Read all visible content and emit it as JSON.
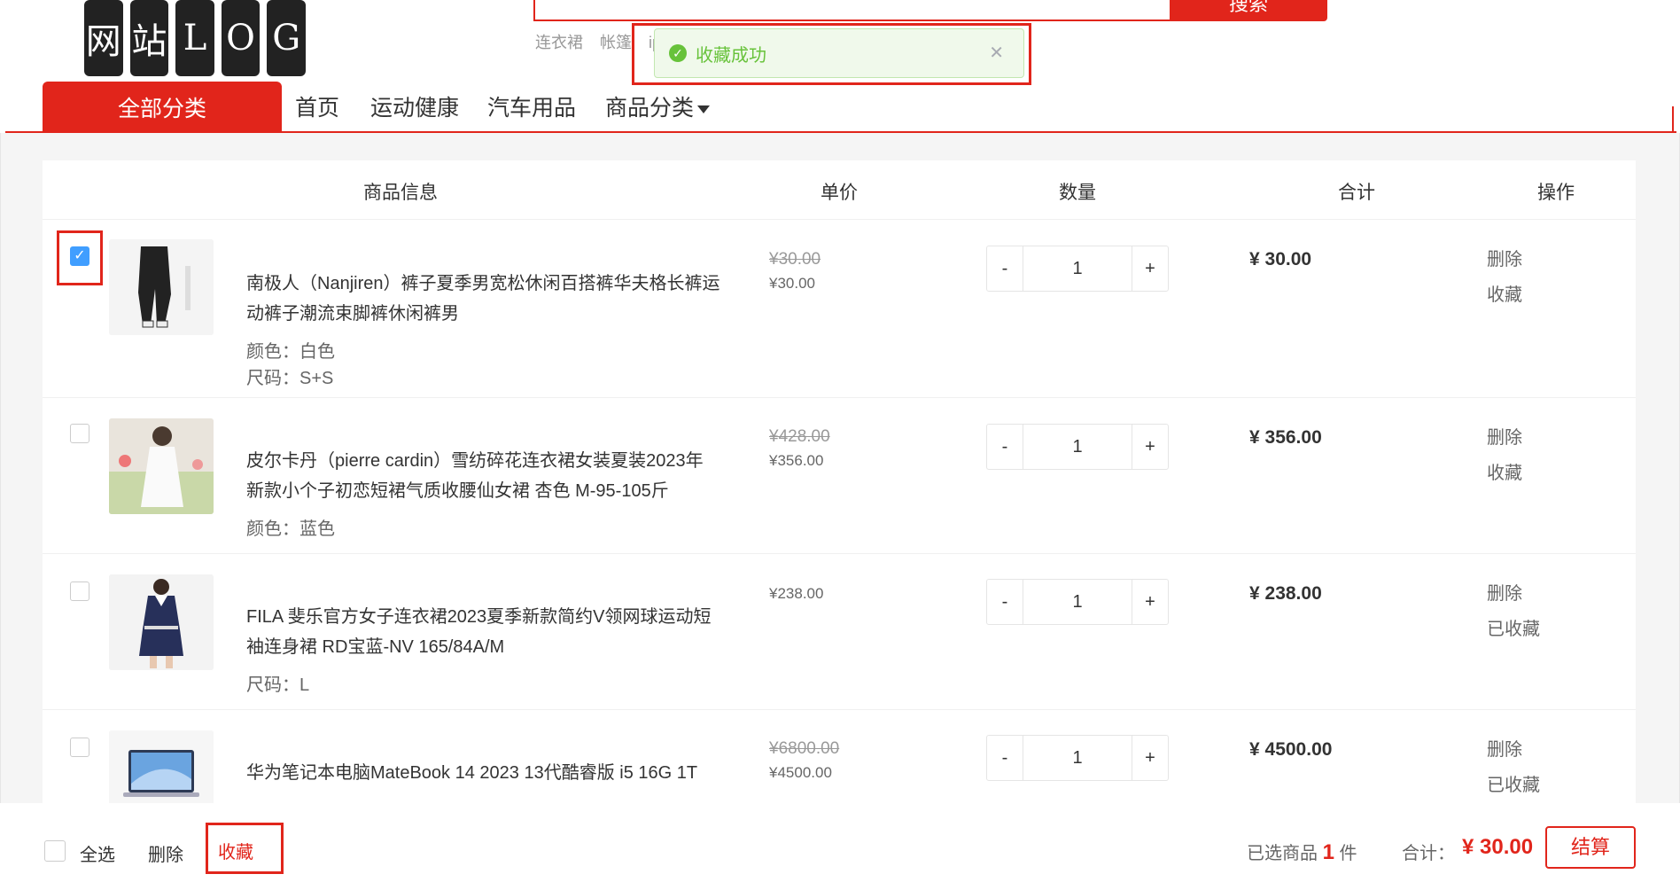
{
  "brand": {
    "logo_text": "网站LOG"
  },
  "search": {
    "button_label": "搜索",
    "hotwords": [
      "连衣裙",
      "帐篷",
      "ip"
    ]
  },
  "nav": {
    "all_label": "全部分类",
    "items": [
      "首页",
      "运动健康",
      "汽车用品",
      "商品分类"
    ]
  },
  "toast": {
    "message": "收藏成功"
  },
  "table": {
    "headers": [
      "商品信息",
      "单价",
      "数量",
      "合计",
      "操作"
    ],
    "rows": [
      {
        "checked": true,
        "name_line1": "南极人（Nanjiren）裤子夏季男宽松休闲百搭裤华夫格长裤运",
        "name_line2": "动裤子潮流束脚裤休闲裤男",
        "attr1": "颜色：白色",
        "attr2": "尺码：S+S",
        "old_price": "¥30.00",
        "price": "¥30.00",
        "qty": "1",
        "subtotal": "¥ 30.00",
        "op1": "删除",
        "op2": "收藏"
      },
      {
        "checked": false,
        "name_line1": "皮尔卡丹（pierre cardin）雪纺碎花连衣裙女装夏装2023年",
        "name_line2": "新款小个子初恋短裙气质收腰仙女裙 杏色 M-95-105斤",
        "attr1": "颜色：蓝色",
        "attr2": "",
        "old_price": "¥428.00",
        "price": "¥356.00",
        "qty": "1",
        "subtotal": "¥ 356.00",
        "op1": "删除",
        "op2": "收藏"
      },
      {
        "checked": false,
        "name_line1": "FILA 斐乐官方女子连衣裙2023夏季新款简约V领网球运动短",
        "name_line2": "袖连身裙 RD宝蓝-NV 165/84A/M",
        "attr1": "尺码：L",
        "attr2": "",
        "old_price": "",
        "price": "¥238.00",
        "qty": "1",
        "subtotal": "¥ 238.00",
        "op1": "删除",
        "op2": "已收藏"
      },
      {
        "checked": false,
        "name_line1": "华为笔记本电脑MateBook 14 2023 13代酷睿版 i5 16G 1T",
        "name_line2": "",
        "attr1": "",
        "attr2": "",
        "old_price": "¥6800.00",
        "price": "¥4500.00",
        "qty": "1",
        "subtotal": "¥ 4500.00",
        "op1": "删除",
        "op2": "已收藏"
      }
    ]
  },
  "qty_controls": {
    "minus": "-",
    "plus": "+"
  },
  "footer": {
    "select_all": "全选",
    "delete": "删除",
    "favorite": "收藏",
    "selected_prefix": "已选商品",
    "selected_count": "1",
    "selected_suffix": "件",
    "total_label": "合计：",
    "total_value": "¥ 30.00",
    "checkout": "结算"
  },
  "colors": {
    "accent": "#e1251b",
    "success": "#67c23a",
    "checkbox": "#409eff"
  }
}
